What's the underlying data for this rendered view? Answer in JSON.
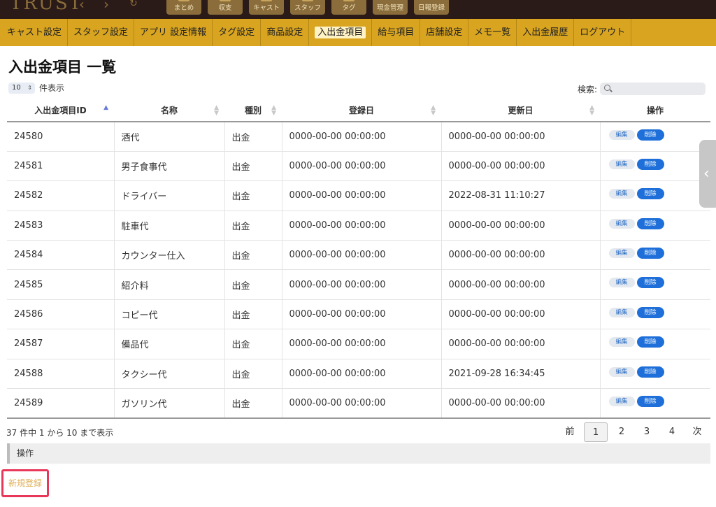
{
  "header": {
    "logo": "TRUST",
    "nav_buttons": [
      "まとめ",
      "収支",
      "キャスト",
      "スタッフ",
      "タグ",
      "現金管理",
      "日報登録"
    ]
  },
  "nav": {
    "items": [
      "キャスト設定",
      "スタッフ設定",
      "アプリ 設定情報",
      "タグ設定",
      "商品設定",
      "入出金項目",
      "給与項目",
      "店舗設定",
      "メモ一覧",
      "入出金履歴",
      "ログアウト"
    ],
    "active_index": 5
  },
  "page": {
    "title": "入出金項目 一覧",
    "length_value": "10",
    "length_label": "件表示",
    "search_label": "検索:"
  },
  "table": {
    "columns": [
      "入出金項目ID",
      "名称",
      "種別",
      "登録日",
      "更新日",
      "操作"
    ],
    "edit_label": "編集",
    "delete_label": "削除",
    "rows": [
      [
        "24580",
        "酒代",
        "出金",
        "0000-00-00 00:00:00",
        "0000-00-00 00:00:00"
      ],
      [
        "24581",
        "男子食事代",
        "出金",
        "0000-00-00 00:00:00",
        "0000-00-00 00:00:00"
      ],
      [
        "24582",
        "ドライバー",
        "出金",
        "0000-00-00 00:00:00",
        "2022-08-31 11:10:27"
      ],
      [
        "24583",
        "駐車代",
        "出金",
        "0000-00-00 00:00:00",
        "0000-00-00 00:00:00"
      ],
      [
        "24584",
        "カウンター仕入",
        "出金",
        "0000-00-00 00:00:00",
        "0000-00-00 00:00:00"
      ],
      [
        "24585",
        "紹介料",
        "出金",
        "0000-00-00 00:00:00",
        "0000-00-00 00:00:00"
      ],
      [
        "24586",
        "コピー代",
        "出金",
        "0000-00-00 00:00:00",
        "0000-00-00 00:00:00"
      ],
      [
        "24587",
        "備品代",
        "出金",
        "0000-00-00 00:00:00",
        "0000-00-00 00:00:00"
      ],
      [
        "24588",
        "タクシー代",
        "出金",
        "0000-00-00 00:00:00",
        "2021-09-28 16:34:45"
      ],
      [
        "24589",
        "ガソリン代",
        "出金",
        "0000-00-00 00:00:00",
        "0000-00-00 00:00:00"
      ]
    ]
  },
  "footer": {
    "info": "37 件中 1 から 10 まで表示",
    "pager": [
      "前",
      "1",
      "2",
      "3",
      "4",
      "次"
    ],
    "current_page": "1",
    "ops_label": "操作",
    "new_button": "新規登録"
  },
  "colors": {
    "nav_bg": "#d9a520",
    "topbar_bg": "#2a1a18",
    "delete_button": "#1e6fd9",
    "highlight_border": "#e8385a"
  }
}
